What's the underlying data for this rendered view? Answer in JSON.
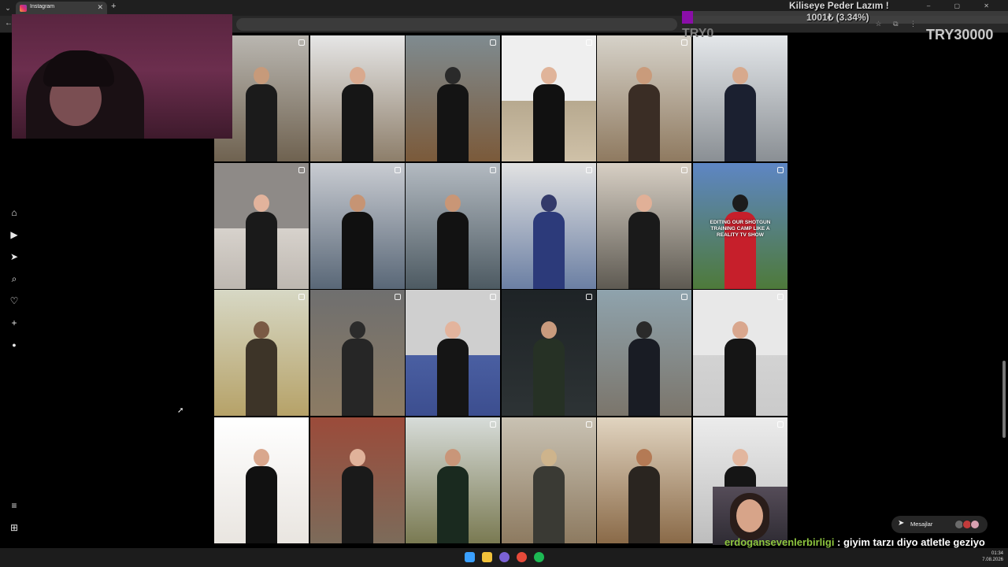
{
  "browser": {
    "tab_title": "Instagram",
    "tab_close": "✕",
    "new_tab": "+",
    "menu": "⌄",
    "window_controls": "– ▢ ✕",
    "back": "←",
    "url_text": "",
    "extensions": "☆ ⧉ ⋮"
  },
  "sidebar": {
    "items": [
      {
        "name": "home-icon",
        "glyph": "⌂"
      },
      {
        "name": "reels-icon",
        "glyph": "▶"
      },
      {
        "name": "send-icon",
        "glyph": "➤"
      },
      {
        "name": "search-icon",
        "glyph": "⌕"
      },
      {
        "name": "heart-icon",
        "glyph": "♡"
      },
      {
        "name": "create-icon",
        "glyph": "+"
      },
      {
        "name": "profile-avatar-icon",
        "glyph": "●"
      }
    ],
    "more_glyph": "≡",
    "meta_glyph": "⊞"
  },
  "grid": {
    "posts": [
      {
        "bg": "linear-gradient(180deg,#b9b6b0,#6f6250)",
        "skin": "#c79a7a",
        "body": "#1b1b1b",
        "badge": true,
        "caption": ""
      },
      {
        "bg": "linear-gradient(180deg,#e6e6e6,#8d7e6a)",
        "skin": "#d9a98e",
        "body": "#161616",
        "badge": false,
        "caption": ""
      },
      {
        "bg": "linear-gradient(180deg,#7f8b90,#7b5a3a)",
        "skin": "#2a2a2a",
        "body": "#141414",
        "badge": true,
        "caption": ""
      },
      {
        "bg": "linear-gradient(180deg,#efefef 0%,#efefef 52%,#b7a98f 52%,#cfc1a8 100%)",
        "skin": "#e0b49a",
        "body": "#111111",
        "badge": true,
        "caption": ""
      },
      {
        "bg": "linear-gradient(180deg,#d6d2c9,#8f7a60)",
        "skin": "#c99b7b",
        "body": "#3a2d25",
        "badge": true,
        "caption": ""
      },
      {
        "bg": "linear-gradient(180deg,#e4e7ea,#8a8f94)",
        "skin": "#d7a98d",
        "body": "#1b2030",
        "badge": false,
        "caption": ""
      },
      {
        "bg": "linear-gradient(180deg,#8e8a87 0%,#8e8a87 52%,#d7d2cc 52%,#bdb7b0 100%)",
        "skin": "#e2b39c",
        "body": "#1a1a1a",
        "badge": true,
        "caption": ""
      },
      {
        "bg": "linear-gradient(180deg,#c9ccd2,#596777)",
        "skin": "#c69474",
        "body": "#101010",
        "badge": true,
        "caption": ""
      },
      {
        "bg": "linear-gradient(180deg,#b3bac1,#4d5a62)",
        "skin": "#c99676",
        "body": "#121212",
        "badge": true,
        "caption": ""
      },
      {
        "bg": "linear-gradient(180deg,#e2e2e2,#6b7fa3)",
        "skin": "#333a6a",
        "body": "#2c3a7a",
        "badge": true,
        "caption": ""
      },
      {
        "bg": "linear-gradient(180deg,#d7cfc4,#5e5a52)",
        "skin": "#e1b097",
        "body": "#1a1a1a",
        "badge": true,
        "caption": ""
      },
      {
        "bg": "linear-gradient(180deg,#5e86c4,#4e7a3a)",
        "skin": "#1c1c1c",
        "body": "#c61f2b",
        "badge": true,
        "caption": "EDITING OUR SHOTGUN TRAINING CAMP LIKE A REALITY TV SHOW"
      },
      {
        "bg": "linear-gradient(180deg,#d7d8c5,#b6a268)",
        "skin": "#7a5a44",
        "body": "#3d3428",
        "badge": true,
        "caption": ""
      },
      {
        "bg": "linear-gradient(180deg,#6f6f6f,#8c7b63)",
        "skin": "#2b2b2b",
        "body": "#262626",
        "badge": true,
        "caption": ""
      },
      {
        "bg": "linear-gradient(180deg,#cfcfcf 0%,#cfcfcf 52%,#4a5fa2 52%,#3c4e8f 100%)",
        "skin": "#e3b49d",
        "body": "#151515",
        "badge": true,
        "caption": ""
      },
      {
        "bg": "linear-gradient(180deg,#1e2326,#2d3335)",
        "skin": "#c99b7e",
        "body": "#263125",
        "badge": true,
        "caption": ""
      },
      {
        "bg": "linear-gradient(180deg,#8fa3ad,#7b756b)",
        "skin": "#2a2a2a",
        "body": "#191c24",
        "badge": true,
        "caption": ""
      },
      {
        "bg": "linear-gradient(180deg,#e8e8e8 0%,#e8e8e8 52%,#d3d3d3 52%,#cacaca 100%)",
        "skin": "#d9a78e",
        "body": "#151515",
        "badge": true,
        "caption": ""
      },
      {
        "bg": "linear-gradient(180deg,#ffffff,#e9e5e0)",
        "skin": "#d9a78d",
        "body": "#111111",
        "badge": false,
        "caption": ""
      },
      {
        "bg": "linear-gradient(180deg,#9b4b3a,#7c6b5a)",
        "skin": "#e0b29a",
        "body": "#1a1a1a",
        "badge": false,
        "caption": ""
      },
      {
        "bg": "linear-gradient(180deg,#d7dcd9,#7a7a52)",
        "skin": "#c99679",
        "body": "#1a2a1f",
        "badge": true,
        "caption": ""
      },
      {
        "bg": "linear-gradient(180deg,#c9c2b3,#8d7a60)",
        "skin": "#ceb48c",
        "body": "#3a3a34",
        "badge": true,
        "caption": ""
      },
      {
        "bg": "linear-gradient(180deg,#e1d4c0,#8a6a48)",
        "skin": "#b47a55",
        "body": "#2a2520",
        "badge": false,
        "caption": ""
      },
      {
        "bg": "linear-gradient(180deg,#ececec,#bdbdbd)",
        "skin": "#e2b69e",
        "body": "#151515",
        "badge": true,
        "caption": ""
      }
    ]
  },
  "overlay": {
    "title": "Kiliseye Peder Lazım !",
    "progress_text": "1001₺ (3.34%)",
    "progress_fraction": 0.0334,
    "progress_color": "#8a0ea8",
    "start_label": "TRY0",
    "goal_label": "TRY30000"
  },
  "messages": {
    "label": "Mesajlar",
    "avatar_colors": [
      "#6b6b6b",
      "#c23b3b",
      "#d8a0b0"
    ]
  },
  "chat": {
    "username": "erdogansevenlerbirligi",
    "message": " : giyim tarzı diyo atletle geziyo amk ya götü güzel de memesi güzel de inanak ya"
  },
  "taskbar": {
    "icons": [
      {
        "name": "windows-start-icon",
        "color": "#3aa0ff"
      },
      {
        "name": "file-explorer-icon",
        "color": "#f2c23a"
      },
      {
        "name": "teams-icon",
        "color": "#7b62d6"
      },
      {
        "name": "chrome-icon",
        "color": "#e64a3a"
      },
      {
        "name": "spotify-icon",
        "color": "#1db954"
      }
    ],
    "time": "01:34",
    "date": "7.08.2026"
  }
}
